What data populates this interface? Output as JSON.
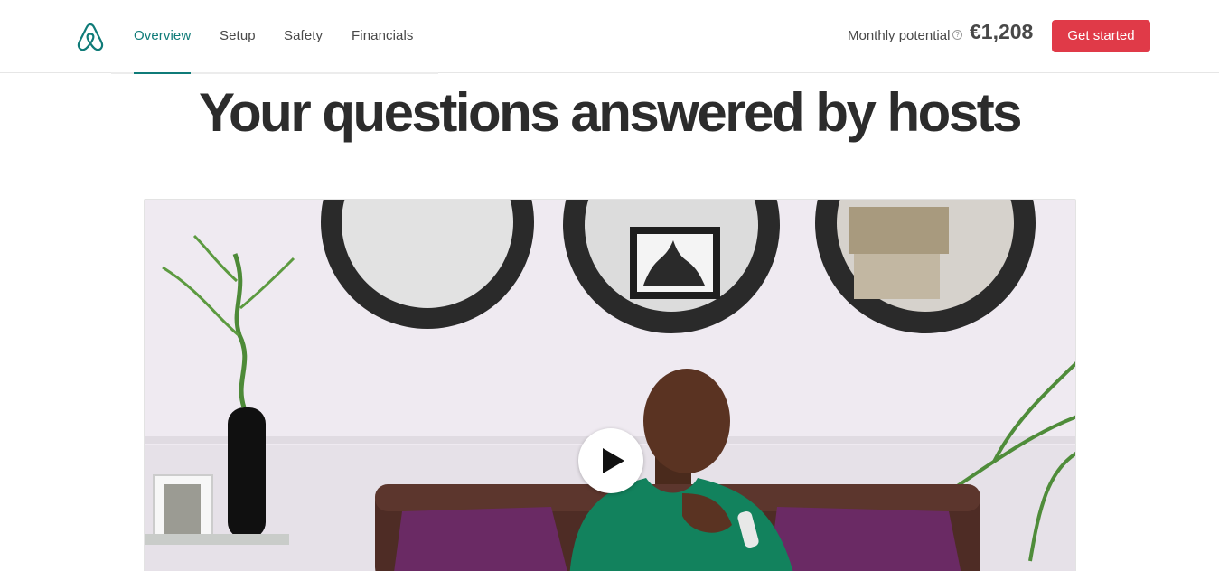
{
  "header": {
    "logo_icon": "airbnb-logo-icon",
    "nav": [
      {
        "label": "Overview",
        "active": true
      },
      {
        "label": "Setup",
        "active": false
      },
      {
        "label": "Safety",
        "active": false
      },
      {
        "label": "Financials",
        "active": false
      }
    ],
    "potential_label": "Monthly potential",
    "help_icon": "question-circle-icon",
    "potential_amount": "€1,208",
    "cta_label": "Get started"
  },
  "main": {
    "title": "Your questions answered by hosts",
    "video": {
      "play_icon": "play-icon"
    }
  },
  "colors": {
    "brand": "#0f7b78",
    "cta": "#e03a48",
    "text": "#484848"
  }
}
